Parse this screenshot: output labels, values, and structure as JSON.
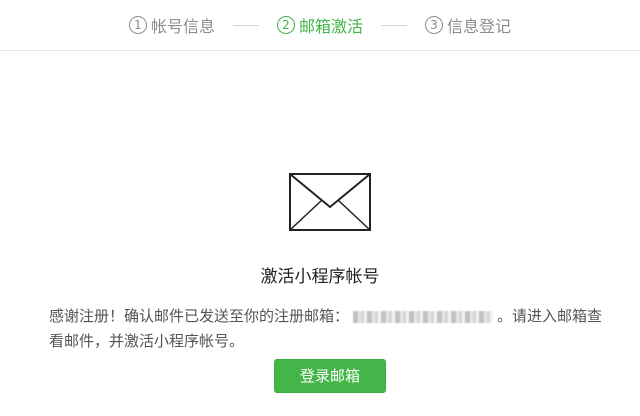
{
  "steps": [
    {
      "number": "1",
      "label": "帐号信息",
      "active": false
    },
    {
      "number": "2",
      "label": "邮箱激活",
      "active": true
    },
    {
      "number": "3",
      "label": "信息登记",
      "active": false
    }
  ],
  "icon": {
    "name": "envelope-icon"
  },
  "main": {
    "title": "激活小程序帐号",
    "desc_before_email": "感谢注册！确认邮件已发送至你的注册邮箱：",
    "desc_after_email": "。请进入邮箱查看邮件，并激活小程序帐号。",
    "login_button": "登录邮箱"
  },
  "colors": {
    "accent": "#44b549",
    "inactive_step": "#8d8d8d"
  }
}
